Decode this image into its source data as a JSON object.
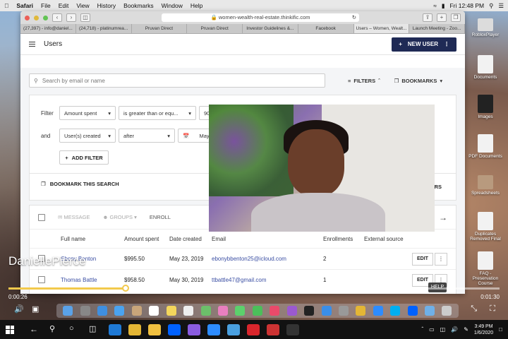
{
  "menubar": {
    "app": "Safari",
    "items": [
      "File",
      "Edit",
      "View",
      "History",
      "Bookmarks",
      "Window",
      "Help"
    ],
    "clock": "Fri 12:48 PM"
  },
  "browser": {
    "url": "women-wealth-real-estate.thinkific.com",
    "tabs": [
      "(27,397) - info@daniel...",
      "(24,718) - platinumrea...",
      "Pruvan Direct",
      "Pruvan Direct",
      "Investor Guidelines &...",
      "Facebook",
      "Users – Women, Wealt...",
      "Launch Meeting - Zoo..."
    ],
    "active_tab": 6
  },
  "app": {
    "title": "Users",
    "new_user_label": "NEW USER",
    "search_placeholder": "Search by email or name",
    "filters_label": "FILTERS",
    "bookmarks_label": "BOOKMARKS",
    "filter": {
      "row1_label": "Filter",
      "row1_field": "Amount spent",
      "row1_op": "is greater than or equ...",
      "row1_value": "900",
      "row2_label": "and",
      "row2_field": "User(s) created",
      "row2_op": "after",
      "row2_value": "May 1,",
      "add_filter_label": "ADD FILTER",
      "bookmark_search_label": "BOOKMARK THIS SEARCH",
      "clear_label": "RS"
    },
    "table": {
      "toolbar": [
        "MESSAGE",
        "GROUPS",
        "ENROLL"
      ],
      "columns": [
        "Full name",
        "Amount spent",
        "Date created",
        "Email",
        "Enrollments",
        "External source"
      ],
      "rows": [
        {
          "name": "Ebony Benton",
          "amount": "$995.50",
          "date": "May 23, 2019",
          "email": "ebonybbenton25@icloud.com",
          "enrollments": "2"
        },
        {
          "name": "Thomas Battle",
          "amount": "$958.50",
          "date": "May 30, 2019",
          "email": "ttbattle47@gmail.com",
          "enrollments": "1"
        }
      ],
      "edit_label": "EDIT"
    }
  },
  "player": {
    "caption": "DaniellePierce",
    "time_elapsed": "0:00:26",
    "time_total": "0:01:30",
    "progress": 0.24,
    "help_label": "HELP"
  },
  "desktop_icons": [
    "RobloxPlayer",
    "Documents",
    "Images",
    "PDF Documents",
    "Spreadsheets",
    "Duplicates Removed Final",
    "FAQ - Preservation Course"
  ],
  "taskbar": {
    "time": "3:49 PM",
    "date": "1/6/2020"
  }
}
